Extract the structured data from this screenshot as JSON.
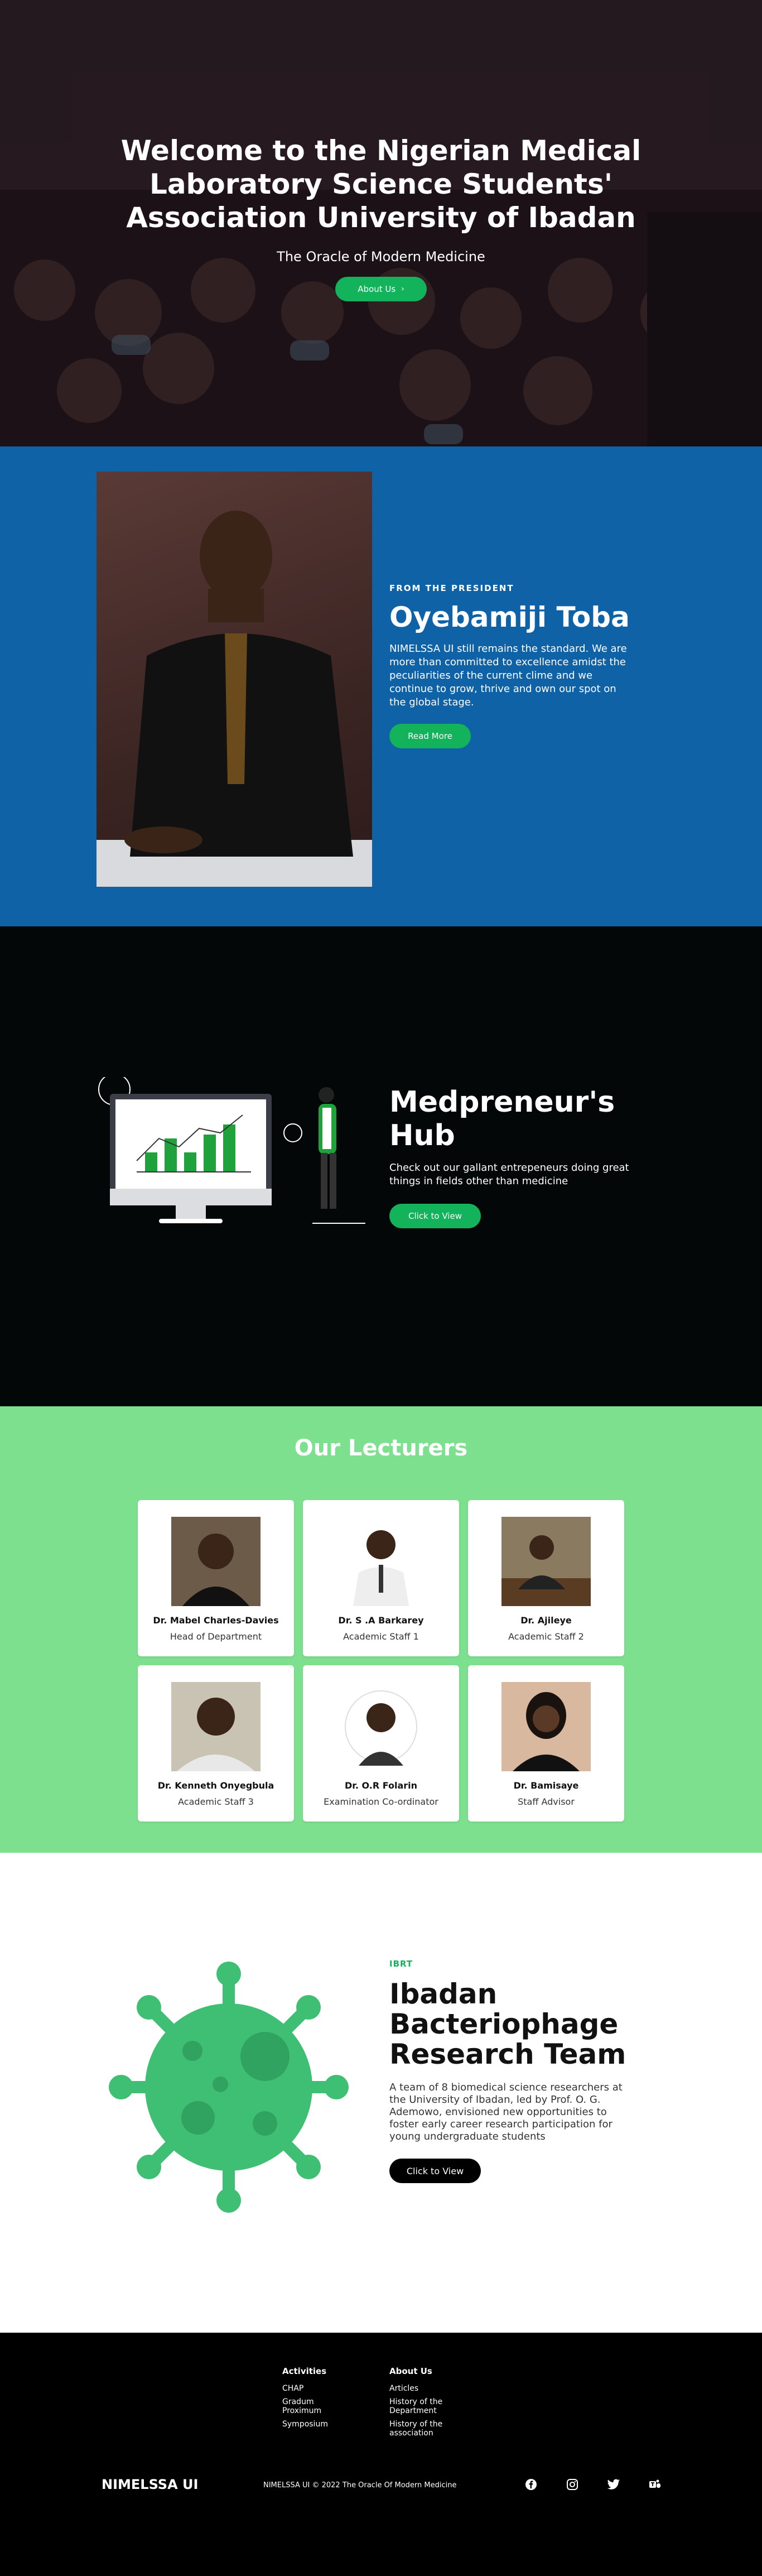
{
  "hero": {
    "title": "Welcome to the Nigerian Medical Laboratory Science Students' Association University of Ibadan",
    "subtitle": "The Oracle of Modern Medicine",
    "button_label": "About Us",
    "button_icon": "chevron-right-icon"
  },
  "president": {
    "eyebrow": "FROM THE PRESIDENT",
    "name": "Oyebamiji Toba",
    "body": "NIMELSSA UI still remains the standard. We are more than committed to excellence amidst the peculiarities of the current clime and we continue to grow, thrive and own our spot on the global stage.",
    "button_label": "Read More"
  },
  "medpreneur": {
    "title": "Medpreneur's Hub",
    "body": "Check out our gallant entrepeneurs doing great things in fields other than medicine",
    "button_label": "Click to View"
  },
  "lecturers": {
    "title": "Our Lecturers",
    "items": [
      {
        "name": "Dr. Mabel Charles-Davies",
        "role": "Head of Department"
      },
      {
        "name": "Dr. S .A Barkarey",
        "role": "Academic Staff 1"
      },
      {
        "name": "Dr. Ajileye",
        "role": "Academic Staff 2"
      },
      {
        "name": "Dr. Kenneth Onyegbula",
        "role": "Academic Staff 3"
      },
      {
        "name": "Dr. O.R Folarin",
        "role": "Examination Co-ordinator"
      },
      {
        "name": "Dr. Bamisaye",
        "role": "Staff Advisor"
      }
    ]
  },
  "ibrt": {
    "eyebrow": "IBRT",
    "title": "Ibadan Bacteriophage Research Team",
    "body": "A team of 8 biomedical science researchers at the University of Ibadan, led by Prof. O. G. Ademowo, envisioned new opportunities to foster early career research participation for young undergraduate students",
    "button_label": "Click to View"
  },
  "footer": {
    "activities": {
      "heading": "Activities",
      "links": [
        "CHAP",
        "Gradum Proximum",
        "Symposium"
      ]
    },
    "about": {
      "heading": "About Us",
      "links": [
        "Articles",
        "History of the Department",
        "History of the association"
      ]
    },
    "brand": "NIMELSSA UI",
    "copyright": "NIMELSSA UI © 2022 The Oracle Of Modern Medicine",
    "social_icons": [
      "facebook-icon",
      "instagram-icon",
      "twitter-icon",
      "teams-icon"
    ]
  },
  "colors": {
    "accent_green": "#13b35c",
    "president_blue": "#1062a6",
    "lecturers_green": "#7de08f"
  }
}
